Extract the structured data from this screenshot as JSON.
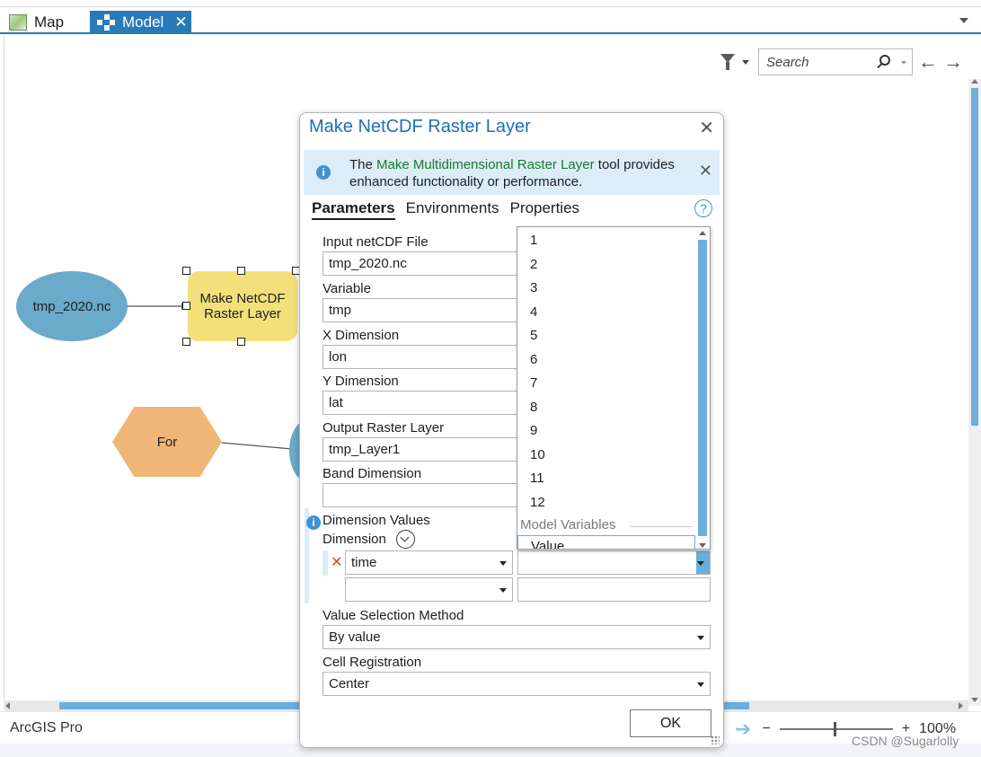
{
  "tabs": [
    {
      "label": "Map",
      "icon": "map-icon"
    },
    {
      "label": "Model",
      "icon": "model-icon",
      "active": true,
      "close": "✕"
    }
  ],
  "toolbar": {
    "search_placeholder": "Search",
    "back_arrow": "←",
    "forward_arrow": "→"
  },
  "model": {
    "input_node": "tmp_2020.nc",
    "tool_node": "Make NetCDF Raster Layer",
    "iterator_node": "For"
  },
  "dialog": {
    "title": "Make NetCDF Raster Layer",
    "close": "✕",
    "banner": {
      "prefix": "The ",
      "link": "Make Multidimensional Raster Layer",
      "suffix": " tool provides enhanced functionality or performance.",
      "close": "✕"
    },
    "tabs": [
      "Parameters",
      "Environments",
      "Properties"
    ],
    "help": "?",
    "params": {
      "input_label": "Input netCDF File",
      "input_value": "tmp_2020.nc",
      "variable_label": "Variable",
      "variable_value": "tmp",
      "x_label": "X Dimension",
      "x_value": "lon",
      "y_label": "Y Dimension",
      "y_value": "lat",
      "output_label": "Output Raster Layer",
      "output_value": "tmp_Layer1",
      "band_label": "Band Dimension",
      "band_value": "",
      "dimvals_label": "Dimension Values",
      "dimension_label": "Dimension",
      "row_remove": "✕",
      "row1_dimension": "time",
      "row1_value": "",
      "row2_dimension": "",
      "row2_value": "",
      "method_label": "Value Selection Method",
      "method_value": "By value",
      "cell_label": "Cell Registration",
      "cell_value": "Center"
    },
    "ok": "OK"
  },
  "dropdown": {
    "items": [
      "1",
      "2",
      "3",
      "4",
      "5",
      "6",
      "7",
      "8",
      "9",
      "10",
      "11",
      "12"
    ],
    "group_label": "Model Variables",
    "partial_item": "Value"
  },
  "status": {
    "app": "ArcGIS Pro",
    "zoom_minus": "−",
    "zoom_plus": "+",
    "zoom": "100%"
  },
  "watermark": "CSDN @Sugarlolly",
  "colors": {
    "accent": "#2a7ab8",
    "title": "#1f6fb2",
    "input_node": "#6aaacb",
    "tool_node": "#f3e07b",
    "iterator_node": "#f0b678",
    "banner_link": "#1b7a2a"
  }
}
